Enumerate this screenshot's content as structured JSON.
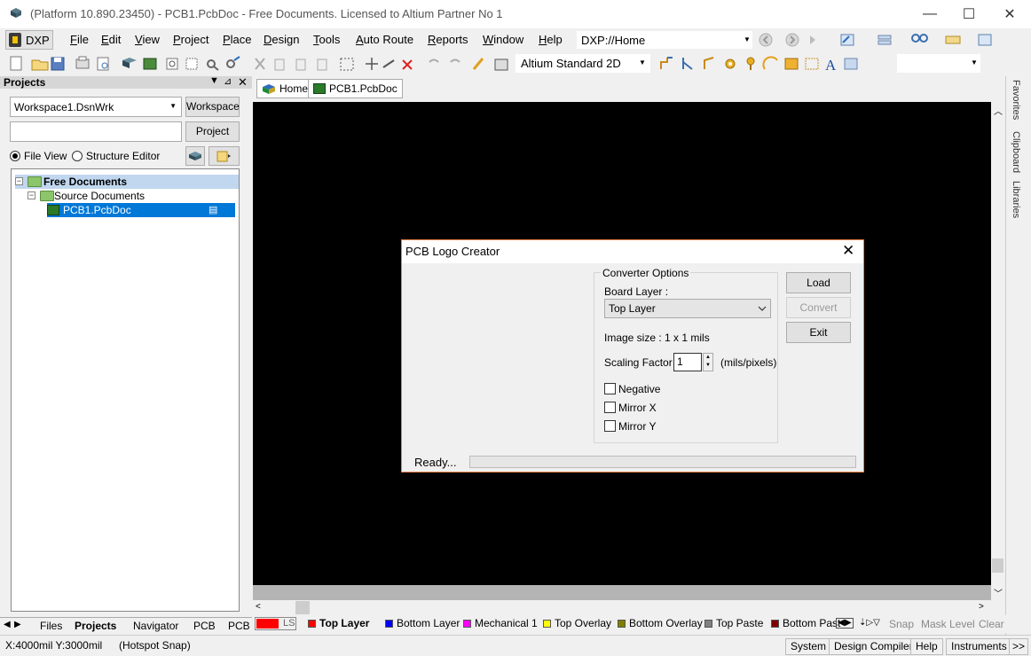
{
  "window": {
    "title": "(Platform 10.890.23450) - PCB1.PcbDoc - Free Documents. Licensed to Altium Partner No 1",
    "minimize": "—",
    "maximize": "☐",
    "close": "✕"
  },
  "menu": {
    "dxp": "DXP",
    "items": [
      "File",
      "Edit",
      "View",
      "Project",
      "Place",
      "Design",
      "Tools",
      "Auto Route",
      "Reports",
      "Window",
      "Help"
    ],
    "address": "DXP://Home"
  },
  "toolbar": {
    "view_mode": "Altium Standard 2D"
  },
  "projects_panel": {
    "title": "Projects",
    "workspace_value": "Workspace1.DsnWrk",
    "workspace_button": "Workspace",
    "project_value": "",
    "project_button": "Project",
    "view_options": [
      "File View",
      "Structure Editor"
    ],
    "selected_view": "File View",
    "tree": {
      "root": "Free Documents",
      "folder": "Source Documents",
      "file": "PCB1.PcbDoc"
    },
    "bottom_tabs": [
      "Files",
      "Projects",
      "Navigator",
      "PCB",
      "PCB I"
    ]
  },
  "doc_tabs": [
    "Home",
    "PCB1.PcbDoc"
  ],
  "side_tabs": [
    "Favorites",
    "Clipboard",
    "Libraries"
  ],
  "layers": {
    "ls_label": "LS",
    "items": [
      {
        "name": "Top Layer",
        "color": "#ff0000",
        "active": true
      },
      {
        "name": "Bottom Layer",
        "color": "#0000ff",
        "active": false
      },
      {
        "name": "Mechanical 1",
        "color": "#ff00ff",
        "active": false
      },
      {
        "name": "Top Overlay",
        "color": "#ffff00",
        "active": false
      },
      {
        "name": "Bottom Overlay",
        "color": "#808000",
        "active": false
      },
      {
        "name": "Top Paste",
        "color": "#808080",
        "active": false
      },
      {
        "name": "Bottom Past",
        "color": "#800000",
        "active": false
      }
    ],
    "snap": "Snap",
    "mask_level": "Mask Level",
    "clear": "Clear"
  },
  "statusbar": {
    "coords": "X:4000mil Y:3000mil",
    "snap_mode": "(Hotspot Snap)",
    "buttons": [
      "System",
      "Design Compiler",
      "Help",
      "Instruments"
    ],
    "more": ">>"
  },
  "dialog": {
    "title": "PCB Logo Creator",
    "close": "✕",
    "group_title": "Converter Options",
    "board_layer_label": "Board Layer :",
    "board_layer_value": "Top Layer",
    "image_size": "Image size : 1 x 1 mils",
    "scaling_label": "Scaling Factor :",
    "scaling_value": "1",
    "scaling_unit": "(mils/pixels)",
    "options": [
      {
        "label": "Negative",
        "checked": false
      },
      {
        "label": "Mirror X",
        "checked": false
      },
      {
        "label": "Mirror Y",
        "checked": false
      }
    ],
    "buttons": {
      "load": "Load",
      "convert": "Convert",
      "exit": "Exit"
    },
    "status": "Ready..."
  }
}
